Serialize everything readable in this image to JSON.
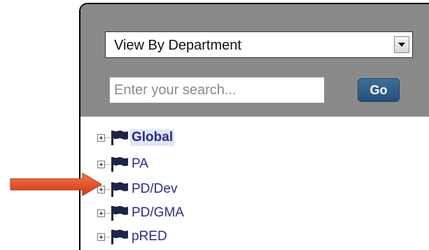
{
  "department_select": {
    "selected": "View By Department"
  },
  "search": {
    "placeholder": "Enter your search...",
    "go_label": "Go"
  },
  "tree": {
    "items": [
      {
        "label": "Global",
        "selected": true
      },
      {
        "label": "PA"
      },
      {
        "label": "PD/Dev"
      },
      {
        "label": "PD/GMA"
      },
      {
        "label": "pRED"
      }
    ]
  },
  "icons": {
    "expander": "plus-box-icon",
    "node": "flag-icon",
    "select": "dropdown-arrow-icon",
    "callout": "arrow-icon"
  },
  "colors": {
    "header_bg": "#898989",
    "go_button": "#2d5d88",
    "node_text": "#2b2b8f",
    "flag": "#1f2344",
    "arrow": "#e2451f"
  }
}
